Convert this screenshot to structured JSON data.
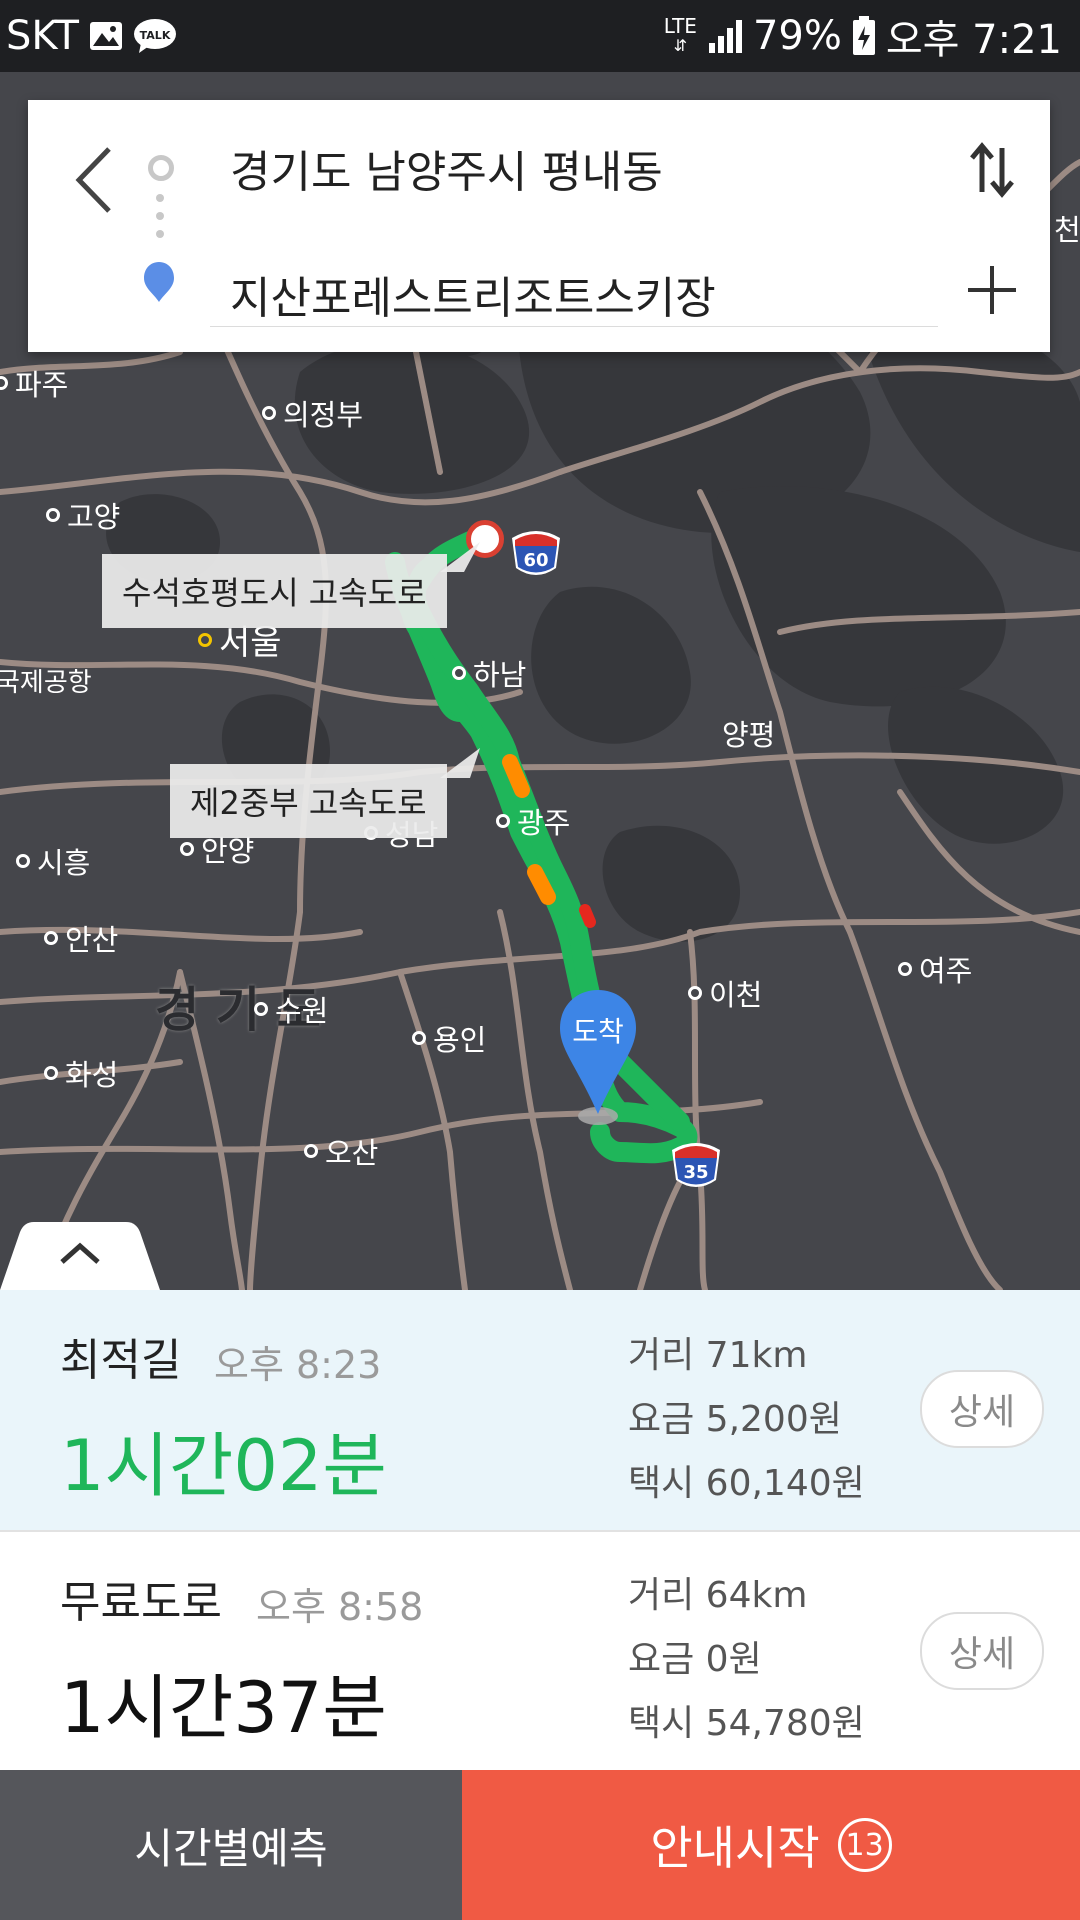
{
  "status_bar": {
    "carrier": "SKT",
    "network": "LTE",
    "battery": "79%",
    "time": "오후 7:21",
    "talk_icon_text": "TALK"
  },
  "search": {
    "origin": "경기도 남양주시 평내동",
    "destination": "지산포레스트리조트스키장"
  },
  "map": {
    "labels": {
      "paju": "파주",
      "uijeongbu": "의정부",
      "goyang": "고양",
      "seoul": "서울",
      "airport": "국제공항",
      "hanam": "하남",
      "yangpyeong": "양평",
      "gwangju": "광주",
      "seongnam": "성남",
      "siheung": "시흥",
      "anyang": "안양",
      "ansan": "안산",
      "gyeonggi": "경 기 도",
      "suwon": "수원",
      "yongin": "용인",
      "icheon": "이천",
      "yeoju": "여주",
      "hwaseong": "화성",
      "osan": "오산",
      "edge_chun": "천"
    },
    "callouts": {
      "top": "수석호평도시 고속도로",
      "middle": "제2중부 고속도로"
    },
    "shields": {
      "a": "60",
      "b": "35"
    },
    "arrival_label": "도착",
    "route_color": "#1fb65a"
  },
  "routes": [
    {
      "name": "최적길",
      "eta": "오후 8:23",
      "duration": "1시간02분",
      "distance": "거리 71km",
      "toll": "요금 5,200원",
      "taxi": "택시 60,140원",
      "detail_label": "상세",
      "duration_color": "#1fb65a"
    },
    {
      "name": "무료도로",
      "eta": "오후 8:58",
      "duration": "1시간37분",
      "distance": "거리 64km",
      "toll": "요금 0원",
      "taxi": "택시 54,780원",
      "detail_label": "상세",
      "duration_color": "#111111"
    }
  ],
  "actions": {
    "time_prediction": "시간별예측",
    "start_guidance": "안내시작",
    "countdown": "13"
  }
}
